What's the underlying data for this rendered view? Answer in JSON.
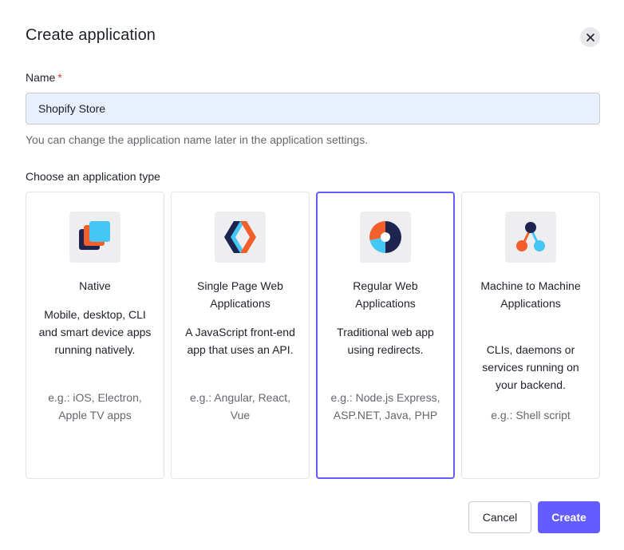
{
  "dialog": {
    "title": "Create application",
    "close_icon": "close-icon"
  },
  "name_field": {
    "label": "Name",
    "required_mark": "*",
    "value": "Shopify Store",
    "helper": "You can change the application name later in the application settings."
  },
  "app_type": {
    "label": "Choose an application type",
    "selected": "regular-web",
    "cards": [
      {
        "id": "native",
        "icon": "native-app-icon",
        "title": "Native",
        "description": "Mobile, desktop, CLI and smart device apps running natively.",
        "examples": "e.g.: iOS, Electron, Apple TV apps"
      },
      {
        "id": "spa",
        "icon": "spa-icon",
        "title": "Single Page Web Applications",
        "description": "A JavaScript front-end app that uses an API.",
        "examples": "e.g.: Angular, React, Vue"
      },
      {
        "id": "regular-web",
        "icon": "regular-web-icon",
        "title": "Regular Web Applications",
        "description": "Traditional web app using redirects.",
        "examples": "e.g.: Node.js Express, ASP.NET, Java, PHP"
      },
      {
        "id": "m2m",
        "icon": "machine-to-machine-icon",
        "title": "Machine to Machine Applications",
        "description": "CLIs, daemons or services running on your backend.",
        "examples": "e.g.: Shell script"
      }
    ]
  },
  "footer": {
    "cancel_label": "Cancel",
    "create_label": "Create"
  },
  "colors": {
    "accent": "#635dff",
    "required": "#d03c38",
    "input_bg": "#e8effd"
  }
}
